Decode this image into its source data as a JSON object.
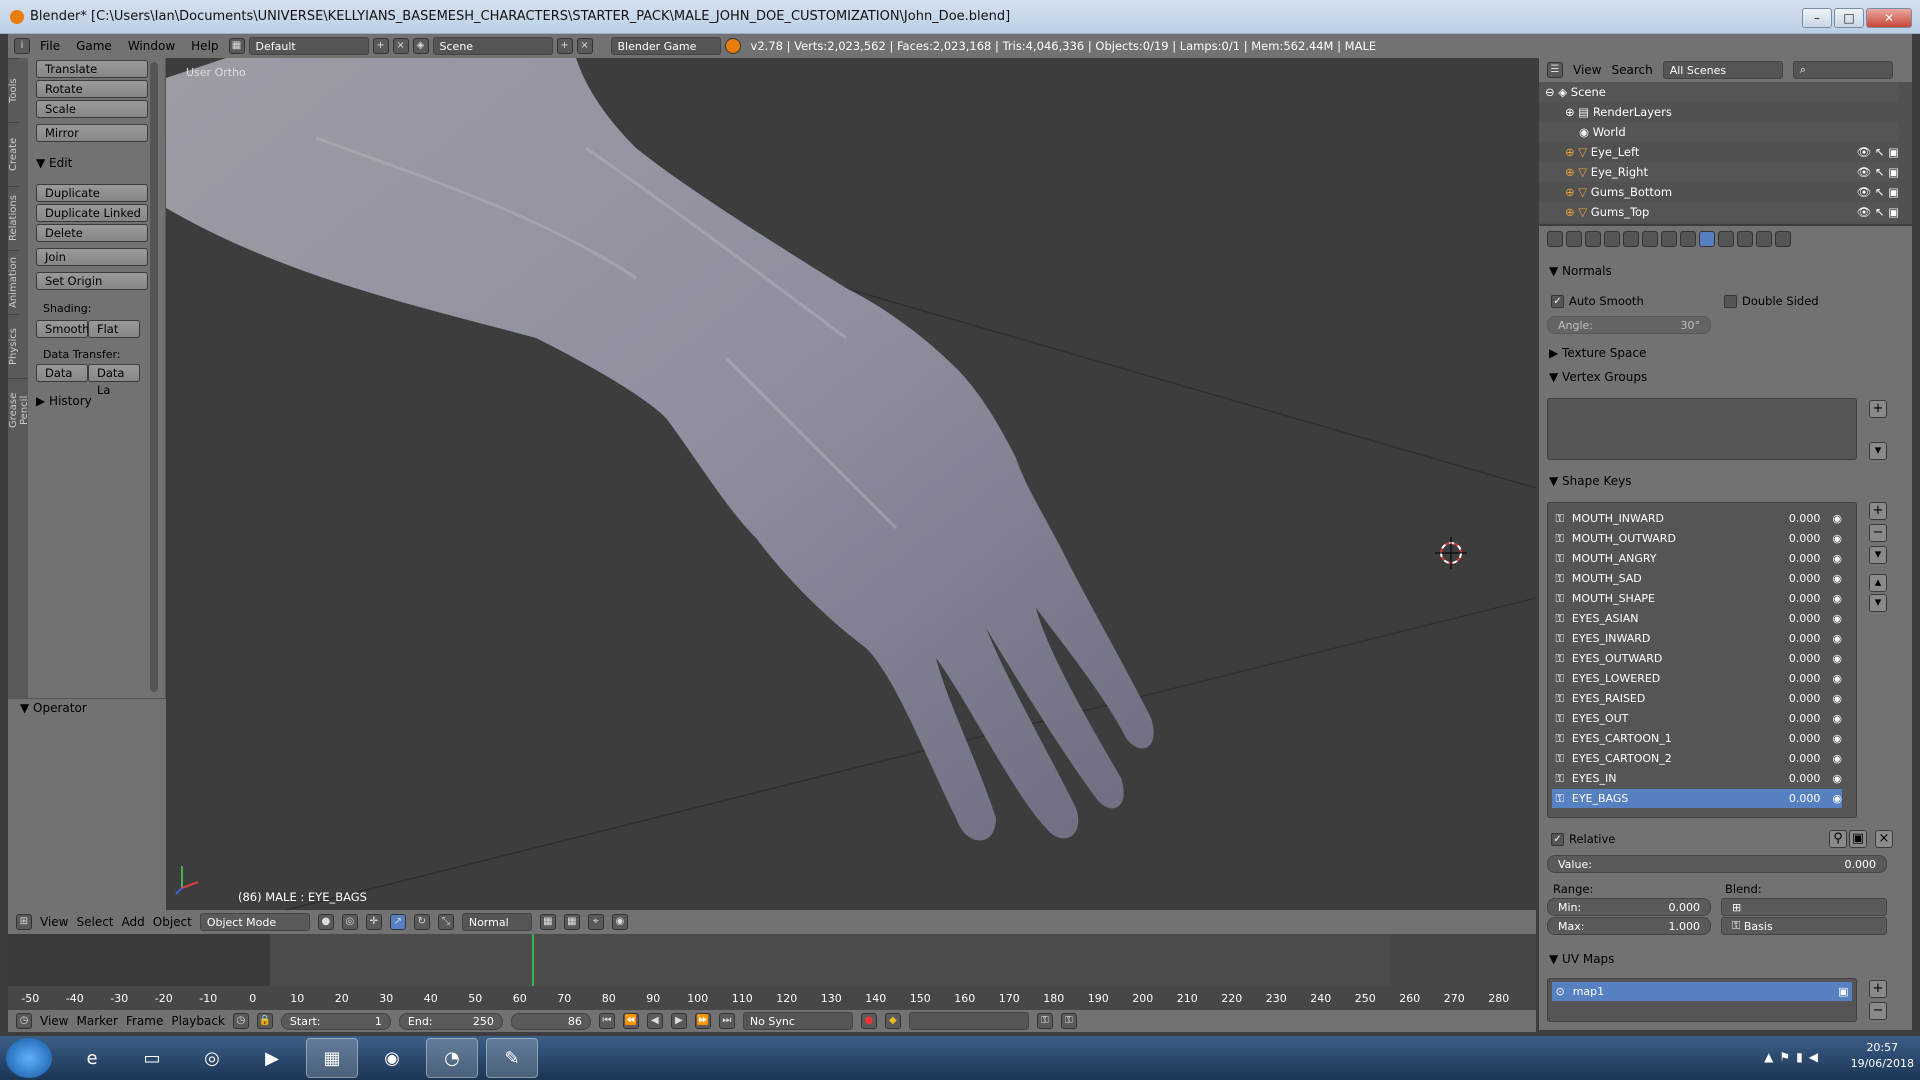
{
  "window": {
    "title": "Blender* [C:\\Users\\Ian\\Documents\\UNIVERSE\\KELLYIANS_BASEMESH_CHARACTERS\\STARTER_PACK\\MALE_JOHN_DOE_CUSTOMIZATION\\John_Doe.blend]",
    "min": "–",
    "max": "□",
    "close": "✕"
  },
  "info_header": {
    "menus": [
      "File",
      "Game",
      "Window",
      "Help"
    ],
    "layout": "Default",
    "scene": "Scene",
    "engine": "Blender Game",
    "stats": "v2.78 | Verts:2,023,562 | Faces:2,023,168 | Tris:4,046,336 | Objects:0/19 | Lamps:0/1 | Mem:562.44M | MALE"
  },
  "left_tabs": [
    "Tools",
    "Create",
    "Relations",
    "Animation",
    "Physics",
    "Grease Pencil"
  ],
  "tool_shelf": {
    "transform": [
      "Translate",
      "Rotate",
      "Scale"
    ],
    "mirror": "Mirror",
    "edit_section": "Edit",
    "edit": [
      "Duplicate",
      "Duplicate Linked",
      "Delete"
    ],
    "join": "Join",
    "set_origin": "Set Origin",
    "shading_label": "Shading:",
    "smooth": "Smooth",
    "flat": "Flat",
    "data_transfer_label": "Data Transfer:",
    "data": "Data",
    "data_la": "Data La",
    "history": "History",
    "operator": "Operator"
  },
  "viewport": {
    "view_label": "User Ortho",
    "object_label": "(86) MALE : EYE_BAGS"
  },
  "viewport_header": {
    "menus": [
      "View",
      "Select",
      "Add",
      "Object"
    ],
    "mode": "Object Mode",
    "pivot": "Normal"
  },
  "timeline": {
    "ruler": [
      "-50",
      "-40",
      "-30",
      "-20",
      "-10",
      "0",
      "10",
      "20",
      "30",
      "40",
      "50",
      "60",
      "70",
      "80",
      "90",
      "100",
      "110",
      "120",
      "130",
      "140",
      "150",
      "160",
      "170",
      "180",
      "190",
      "200",
      "210",
      "220",
      "230",
      "240",
      "250",
      "260",
      "270",
      "280"
    ],
    "current_frame_ratio": 0.343
  },
  "timeline_header": {
    "menus": [
      "View",
      "Marker",
      "Frame",
      "Playback"
    ],
    "start_label": "Start:",
    "start": "1",
    "end_label": "End:",
    "end": "250",
    "current": "86",
    "sync": "No Sync"
  },
  "outliner": {
    "menus": [
      "View",
      "Search"
    ],
    "scenes": "All Scenes",
    "items": [
      "Scene",
      "RenderLayers",
      "World",
      "Eye_Left",
      "Eye_Right",
      "Gums_Bottom",
      "Gums_Top"
    ]
  },
  "properties": {
    "normals": "Normals",
    "auto_smooth": "Auto Smooth",
    "double_sided": "Double Sided",
    "angle_label": "Angle:",
    "angle": "30°",
    "texture_space": "Texture Space",
    "vertex_groups": "Vertex Groups",
    "shape_keys": "Shape Keys",
    "keys": [
      {
        "name": "MOUTH_INWARD",
        "value": "0.000"
      },
      {
        "name": "MOUTH_OUTWARD",
        "value": "0.000"
      },
      {
        "name": "MOUTH_ANGRY",
        "value": "0.000"
      },
      {
        "name": "MOUTH_SAD",
        "value": "0.000"
      },
      {
        "name": "MOUTH_SHAPE",
        "value": "0.000"
      },
      {
        "name": "EYES_ASIAN",
        "value": "0.000"
      },
      {
        "name": "EYES_INWARD",
        "value": "0.000"
      },
      {
        "name": "EYES_OUTWARD",
        "value": "0.000"
      },
      {
        "name": "EYES_LOWERED",
        "value": "0.000"
      },
      {
        "name": "EYES_RAISED",
        "value": "0.000"
      },
      {
        "name": "EYES_OUT",
        "value": "0.000"
      },
      {
        "name": "EYES_CARTOON_1",
        "value": "0.000"
      },
      {
        "name": "EYES_CARTOON_2",
        "value": "0.000"
      },
      {
        "name": "EYES_IN",
        "value": "0.000"
      },
      {
        "name": "EYE_BAGS",
        "value": "0.000"
      }
    ],
    "relative": "Relative",
    "value_label": "Value:",
    "value": "0.000",
    "range_label": "Range:",
    "blend_label": "Blend:",
    "min_label": "Min:",
    "min": "0.000",
    "max_label": "Max:",
    "max": "1.000",
    "blend": "Basis",
    "uv_maps": "UV Maps",
    "uv_map": "map1"
  },
  "taskbar": {
    "apps": [
      "ie-icon",
      "explorer-icon",
      "chrome-icon",
      "media-icon",
      "app-icon",
      "obs-icon",
      "blender-icon",
      "paint-icon"
    ],
    "time": "20:57",
    "date": "19/06/2018"
  },
  "colors": {
    "selection": "#5680c2",
    "timeline_cursor": "#3cb34a"
  }
}
